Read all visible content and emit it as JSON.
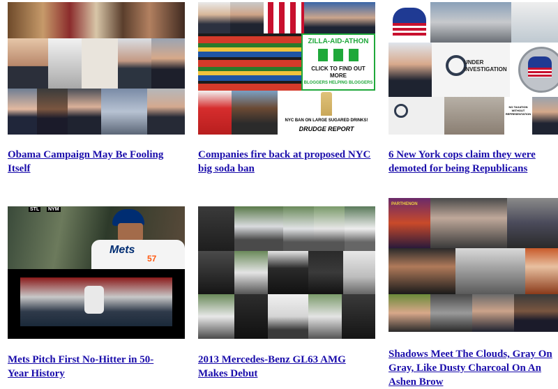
{
  "articles": [
    {
      "title": "Obama Campaign May Be Fooling Itself"
    },
    {
      "title": "Companies fire back at proposed NYC big soda ban",
      "overlay": {
        "zilla_title": "ZILLA-AID-ATHON",
        "zilla_cta": "CLICK TO FIND OUT MORE",
        "zilla_sub": "BLOGGERS HELPING BLOGGERS",
        "ban_caption": "NYC BAN ON LARGE SUGARED DRINKS!",
        "source": "DRUDGE REPORT"
      }
    },
    {
      "title": "6 New York cops claim they were demoted for being Republicans",
      "overlay": {
        "under_investigation": "UNDER INVESTIGATION",
        "sign_text": "NO TAXATION WITHOUT REPRESENTATION"
      }
    },
    {
      "title": "Mets Pitch First No-Hitter in 50-Year History",
      "overlay": {
        "score_team": "STL",
        "score_team2": "NYM",
        "jersey": "Mets",
        "number": "57"
      }
    },
    {
      "title": "2013 Mercedes-Benz GL63 AMG Makes Debut"
    },
    {
      "title": "Shadows Meet The Clouds, Gray On Gray, Like Dusty Charcoal On An Ashen Brow",
      "overlay": {
        "banner": "PARTHENON"
      }
    }
  ],
  "colors": {
    "link": "#1a0dab",
    "zilla_green": "#1fa83a",
    "gop_red": "#c8102e",
    "gop_blue": "#1f3a93",
    "mets_blue": "#002d72",
    "mets_orange": "#ff5910"
  }
}
